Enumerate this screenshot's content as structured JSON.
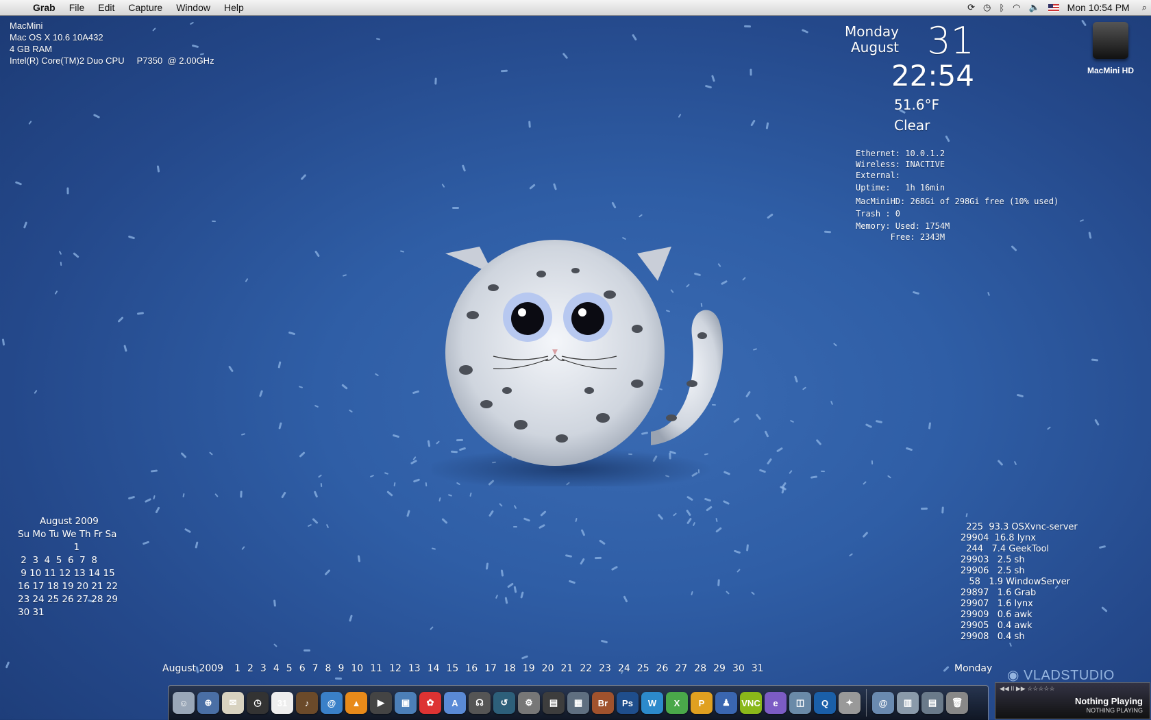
{
  "menubar": {
    "app": "Grab",
    "menus": [
      "File",
      "Edit",
      "Capture",
      "Window",
      "Help"
    ],
    "status_icons": [
      "sync-icon",
      "time-machine-icon",
      "bluetooth-icon",
      "wifi-icon",
      "volume-icon",
      "us-flag-icon"
    ],
    "clock": "Mon 10:54 PM"
  },
  "sysinfo": {
    "line1": "MacMini",
    "line2": "Mac OS X 10.6 10A432",
    "line3": "4 GB RAM",
    "line4": "Intel(R) Core(TM)2 Duo CPU     P7350  @ 2.00GHz"
  },
  "date": {
    "dayname": "Monday",
    "month": "August",
    "day": "31",
    "time": "22:54"
  },
  "weather": {
    "temp": "51.6°F",
    "cond": "Clear"
  },
  "net": {
    "ethernet": "Ethernet: 10.0.1.2",
    "wireless": "Wireless: INACTIVE",
    "external": "External:",
    "uptime": "Uptime:   1h 16min",
    "disk": "MacMiniHD: 268Gi of 298Gi free (10% used)",
    "trash": "Trash : 0",
    "mem_used": "Memory: Used: 1754M",
    "mem_free": "       Free: 2343M"
  },
  "hd": {
    "label": "MacMini HD"
  },
  "calendar": {
    "title": "August 2009",
    "header": "Su Mo Tu We Th Fr Sa",
    "weeks": [
      "                   1",
      " 2  3  4  5  6  7  8",
      " 9 10 11 12 13 14 15",
      "16 17 18 19 20 21 22",
      "23 24 25 26 27 28 29",
      "30 31"
    ]
  },
  "processes": [
    "  225  93.3 OSXvnc-server",
    "29904  16.8 lynx",
    "  244   7.4 GeekTool",
    "29903   2.5 sh",
    "29906   2.5 sh",
    "   58   1.9 WindowServer",
    "29897   1.6 Grab",
    "29907   1.6 lynx",
    "29909   0.6 awk",
    "29905   0.4 awk",
    "29908   0.4 sh"
  ],
  "datestrip": {
    "month": "August 2009",
    "days": [
      "1",
      "2",
      "3",
      "4",
      "5",
      "6",
      "7",
      "8",
      "9",
      "10",
      "11",
      "12",
      "13",
      "14",
      "15",
      "16",
      "17",
      "18",
      "19",
      "20",
      "21",
      "22",
      "23",
      "24",
      "25",
      "26",
      "27",
      "28",
      "29",
      "30",
      "31"
    ],
    "weekday": "Monday"
  },
  "watermark": "VLADSTUDIO",
  "nowplaying": {
    "title": "Nothing Playing",
    "subtitle": "NOTHING PLAYING",
    "controls": "◀◀ II ▶▶ ☆☆☆☆☆"
  },
  "dock": [
    {
      "name": "finder-icon",
      "color": "#9aa7b8",
      "glyph": "☺"
    },
    {
      "name": "safari-icon",
      "color": "#4a6fa5",
      "glyph": "⊕"
    },
    {
      "name": "mail-icon",
      "color": "#d8d2c0",
      "glyph": "✉"
    },
    {
      "name": "dashboard-icon",
      "color": "#333",
      "glyph": "◷"
    },
    {
      "name": "ical-icon",
      "color": "#eee",
      "glyph": "31"
    },
    {
      "name": "garageband-icon",
      "color": "#6b4a2a",
      "glyph": "♪"
    },
    {
      "name": "address-book-icon",
      "color": "#3a80c8",
      "glyph": "@"
    },
    {
      "name": "vlc-icon",
      "color": "#e88a1a",
      "glyph": "▲"
    },
    {
      "name": "imovie-icon",
      "color": "#444",
      "glyph": "▶"
    },
    {
      "name": "iphoto-icon",
      "color": "#4c7fb8",
      "glyph": "▣"
    },
    {
      "name": "flickr-icon",
      "color": "#d33",
      "glyph": "✿"
    },
    {
      "name": "app-store-icon",
      "color": "#5a8ad6",
      "glyph": "A"
    },
    {
      "name": "headphones-icon",
      "color": "#555",
      "glyph": "☊"
    },
    {
      "name": "time-machine-icon",
      "color": "#2d5f7a",
      "glyph": "↺"
    },
    {
      "name": "system-preferences-icon",
      "color": "#777",
      "glyph": "⚙"
    },
    {
      "name": "photo-booth-icon",
      "color": "#3d3d3d",
      "glyph": "▤"
    },
    {
      "name": "expose-icon",
      "color": "#5f6f80",
      "glyph": "▦"
    },
    {
      "name": "bridge-icon",
      "color": "#a0522d",
      "glyph": "Br"
    },
    {
      "name": "photoshop-icon",
      "color": "#1f4e8c",
      "glyph": "Ps"
    },
    {
      "name": "w-app-icon",
      "color": "#2c8acb",
      "glyph": "W"
    },
    {
      "name": "x-app-icon",
      "color": "#4aa84a",
      "glyph": "X"
    },
    {
      "name": "p-app-icon",
      "color": "#e0a020",
      "glyph": "P"
    },
    {
      "name": "user-icon",
      "color": "#3a66b0",
      "glyph": "♟"
    },
    {
      "name": "server-vnc-icon",
      "color": "#8ab81a",
      "glyph": "VNC"
    },
    {
      "name": "e-app-icon",
      "color": "#7c5cc4",
      "glyph": "e"
    },
    {
      "name": "preview-icon",
      "color": "#6a8aa8",
      "glyph": "◫"
    },
    {
      "name": "quicktime-icon",
      "color": "#1a5fa8",
      "glyph": "Q"
    },
    {
      "name": "activity-icon",
      "color": "#999",
      "glyph": "✦"
    }
  ],
  "dock_right": [
    {
      "name": "documents-stack-icon",
      "color": "#6a8ab0",
      "glyph": "@"
    },
    {
      "name": "downloads-stack-icon",
      "color": "#8a9aaa",
      "glyph": "▥"
    },
    {
      "name": "applications-stack-icon",
      "color": "#6a7a8a",
      "glyph": "▤"
    },
    {
      "name": "trash-icon",
      "color": "#888",
      "glyph": "🗑"
    }
  ]
}
